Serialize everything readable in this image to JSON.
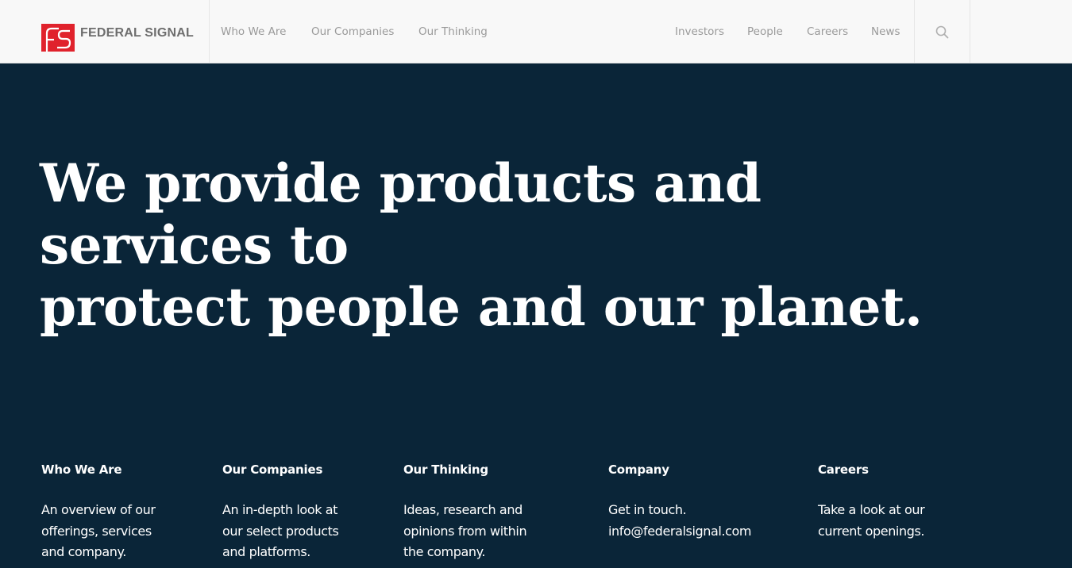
{
  "header": {
    "logo_text": "FEDERAL SIGNAL",
    "nav_primary": [
      {
        "label": "Who We Are"
      },
      {
        "label": "Our Companies"
      },
      {
        "label": "Our Thinking"
      }
    ],
    "nav_secondary": [
      {
        "label": "Investors"
      },
      {
        "label": "People"
      },
      {
        "label": "Careers"
      },
      {
        "label": "News"
      }
    ],
    "search_icon": "search-icon"
  },
  "colors": {
    "brand_red": "#e0222c",
    "hero_background": "#0a2538",
    "nav_text": "#9a9a9a"
  },
  "hero": {
    "line1": "We provide products and services to",
    "line2": "protect people and our planet."
  },
  "footer_columns": [
    {
      "title": "Who We Are",
      "lines": [
        "An overview of our",
        "offerings, services",
        "and company."
      ]
    },
    {
      "title": "Our Companies",
      "lines": [
        "An in-depth look at",
        "our select products",
        "and platforms."
      ]
    },
    {
      "title": "Our Thinking",
      "lines": [
        "Ideas, research and",
        "opinions from within",
        "the company."
      ]
    },
    {
      "title": "Company",
      "lines": [
        "Get in touch.",
        "info@federalsignal.com"
      ]
    },
    {
      "title": "Careers",
      "lines": [
        "Take a look at our",
        "current openings."
      ]
    }
  ]
}
